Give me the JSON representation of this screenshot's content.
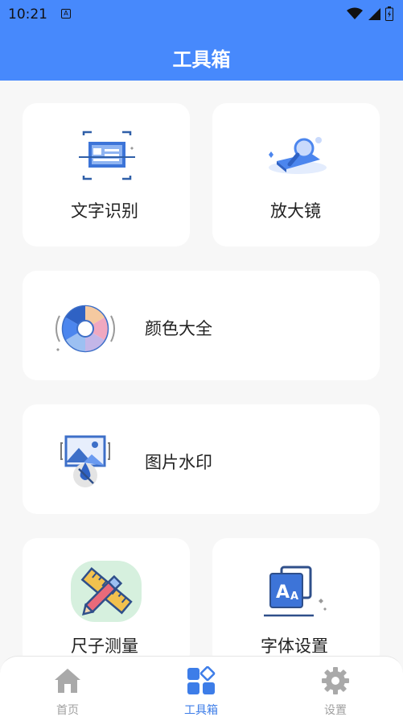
{
  "status_bar": {
    "time": "10:21",
    "notification_glyph": "A"
  },
  "app_bar": {
    "title": "工具箱"
  },
  "tools": [
    {
      "label": "文字识别",
      "icon": "text-recognition-icon"
    },
    {
      "label": "放大镜",
      "icon": "magnifier-icon"
    },
    {
      "label": "颜色大全",
      "icon": "color-wheel-icon"
    },
    {
      "label": "图片水印",
      "icon": "image-watermark-icon"
    },
    {
      "label": "尺子测量",
      "icon": "ruler-icon"
    },
    {
      "label": "字体设置",
      "icon": "font-settings-icon"
    }
  ],
  "bottom_nav": [
    {
      "label": "首页",
      "icon": "home-icon",
      "active": false
    },
    {
      "label": "工具箱",
      "icon": "toolbox-icon",
      "active": true
    },
    {
      "label": "设置",
      "icon": "gear-icon",
      "active": false
    }
  ],
  "colors": {
    "primary": "#4789fc",
    "background": "#f7f7f7",
    "card": "#ffffff",
    "nav_active": "#3d7de8",
    "nav_inactive": "#a0a0a0"
  }
}
